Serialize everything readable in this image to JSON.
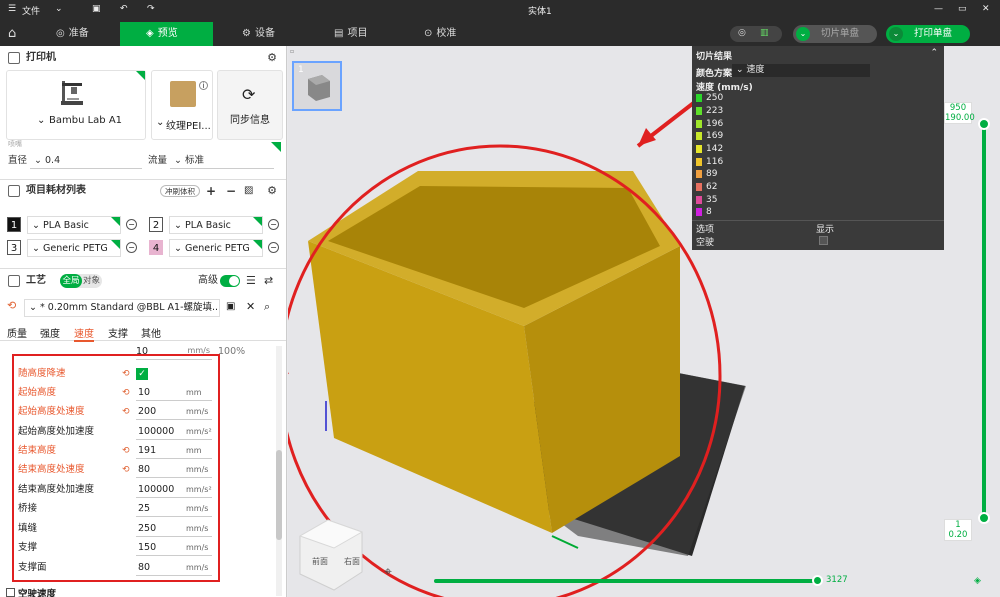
{
  "window": {
    "title": "实体1",
    "menu": "文件"
  },
  "topnav": {
    "tabs": [
      {
        "label": "准备",
        "active": false
      },
      {
        "label": "预览",
        "active": true
      },
      {
        "label": "设备",
        "active": false
      },
      {
        "label": "项目",
        "active": false
      },
      {
        "label": "校准",
        "active": false
      }
    ],
    "slice_plate": "切片单盘",
    "print_plate": "打印单盘"
  },
  "printer": {
    "section_title": "打印机",
    "printer_name": "Bambu Lab A1",
    "plate_name": "纹理PEI...",
    "sync_label": "同步信息",
    "small_caption": "喷嘴",
    "diameter_label": "直径",
    "diameter_value": "0.4",
    "flow_label": "流量",
    "flow_value": "标准"
  },
  "filaments": {
    "section_title": "项目耗材列表",
    "flush_label": "冲刷体积",
    "items": [
      {
        "num": "1",
        "name": "PLA Basic",
        "color": "#111111",
        "text": "#ffffff"
      },
      {
        "num": "2",
        "name": "PLA Basic",
        "color": "#ffffff",
        "text": "#111111"
      },
      {
        "num": "3",
        "name": "Generic PETG",
        "color": "#ffffff",
        "text": "#111111"
      },
      {
        "num": "4",
        "name": "Generic PETG",
        "color": "#e8b4d0",
        "text": "#111111"
      }
    ]
  },
  "process": {
    "section_title": "工艺",
    "toggle_global": "全局",
    "toggle_object": "对象",
    "advanced_label": "高级",
    "preset": "* 0.20mm Standard @BBL A1-螺旋填...",
    "tabs": [
      "质量",
      "强度",
      "速度",
      "支撑",
      "其他"
    ],
    "active_tab": "速度",
    "top_value": "10",
    "top_unit": "mm/s",
    "top_percent": "100%",
    "rows": [
      {
        "label": "随高度降速",
        "value": "",
        "unit": "",
        "modified": true,
        "checkbox": true
      },
      {
        "label": "起始高度",
        "value": "10",
        "unit": "mm",
        "modified": true
      },
      {
        "label": "起始高度处速度",
        "value": "200",
        "unit": "mm/s",
        "modified": true
      },
      {
        "label": "起始高度处加速度",
        "value": "100000",
        "unit": "mm/s²",
        "modified": false
      },
      {
        "label": "结束高度",
        "value": "191",
        "unit": "mm",
        "modified": true
      },
      {
        "label": "结束高度处速度",
        "value": "80",
        "unit": "mm/s",
        "modified": true
      },
      {
        "label": "结束高度处加速度",
        "value": "100000",
        "unit": "mm/s²",
        "modified": false
      },
      {
        "label": "桥接",
        "value": "25",
        "unit": "mm/s",
        "modified": false
      },
      {
        "label": "填缝",
        "value": "250",
        "unit": "mm/s",
        "modified": false
      },
      {
        "label": "支撑",
        "value": "150",
        "unit": "mm/s",
        "modified": false
      },
      {
        "label": "支撑面",
        "value": "80",
        "unit": "mm/s",
        "modified": false
      }
    ],
    "footer": "空驶速度"
  },
  "legend": {
    "title": "切片结果",
    "scheme_label": "颜色方案",
    "scheme_value": "速度",
    "unit_label": "速度 (mm/s)",
    "entries": [
      {
        "v": "250",
        "c": "#2bd62b"
      },
      {
        "v": "223",
        "c": "#5fe02a"
      },
      {
        "v": "196",
        "c": "#9fe62a"
      },
      {
        "v": "169",
        "c": "#c9e82a"
      },
      {
        "v": "142",
        "c": "#e6e62a"
      },
      {
        "v": "116",
        "c": "#f0c52a"
      },
      {
        "v": "89",
        "c": "#f0a040"
      },
      {
        "v": "62",
        "c": "#e87060"
      },
      {
        "v": "35",
        "c": "#e04a9a"
      },
      {
        "v": "8",
        "c": "#d020e0"
      }
    ],
    "opt_label": "选项",
    "show_label": "显示",
    "travel_label": "空驶"
  },
  "viewport": {
    "layer_top": "950",
    "height_top": "190.00",
    "layer_bottom": "1",
    "height_bottom": "0.20",
    "moves": "3127",
    "plate_index": "1",
    "cube_front": "前面",
    "cube_right": "右面"
  }
}
